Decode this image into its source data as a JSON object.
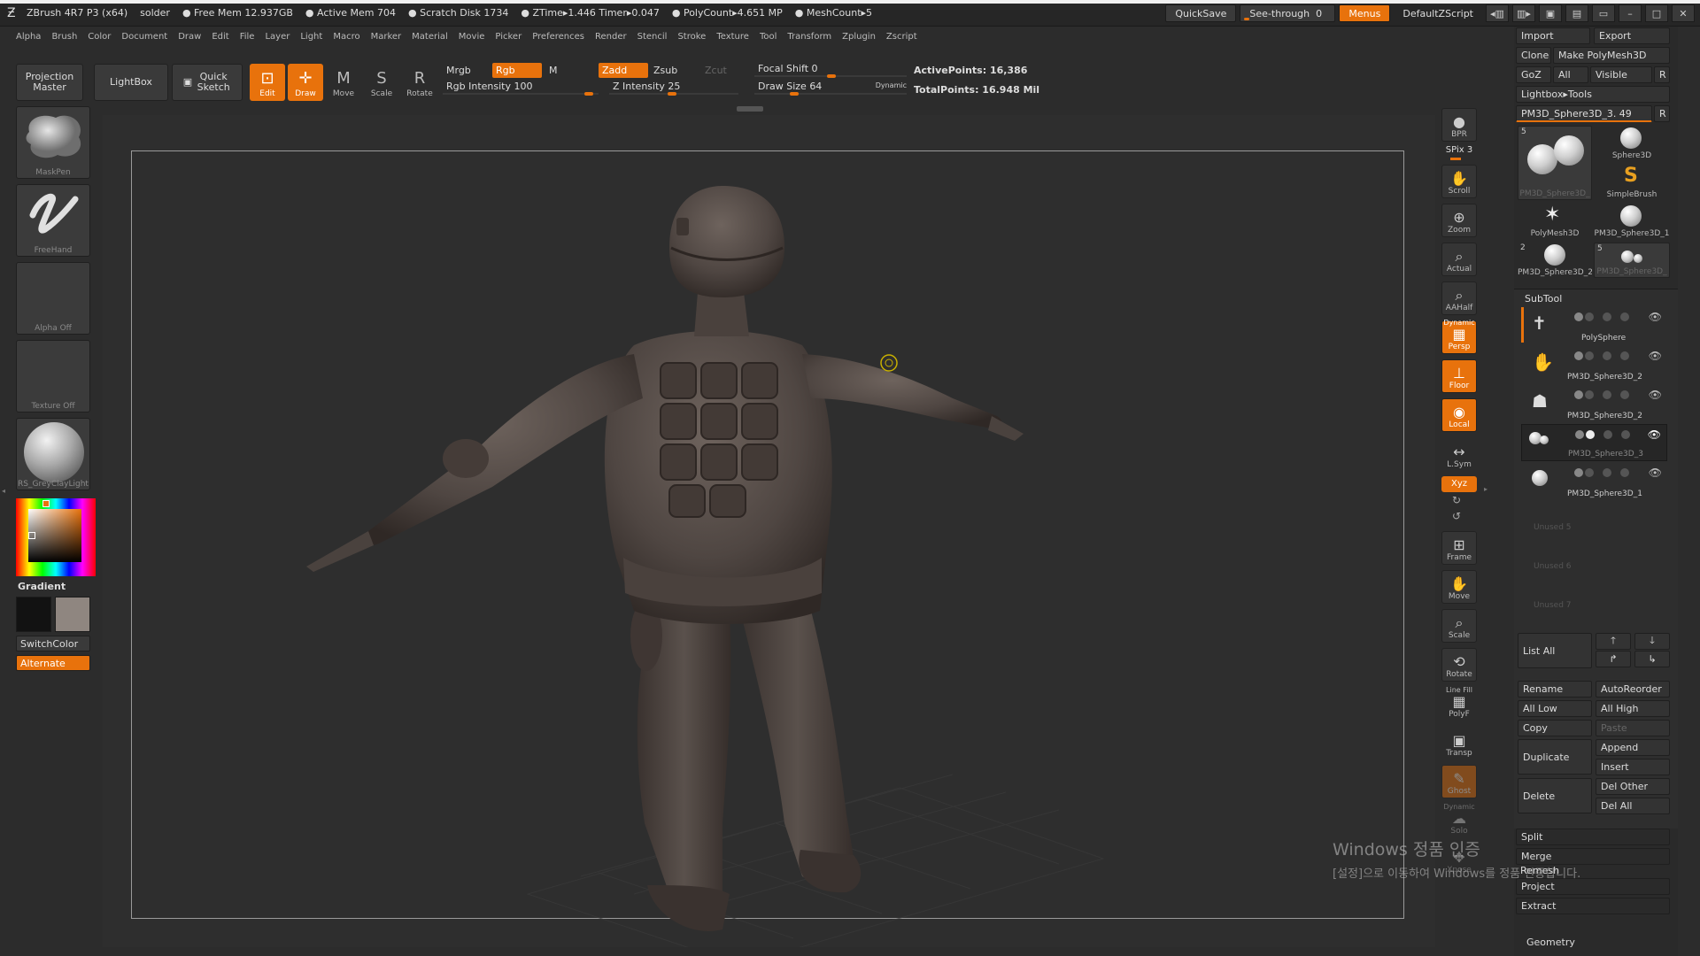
{
  "title_bar": {
    "app": "ZBrush 4R7 P3 (x64)",
    "file": "solder",
    "free_mem": "● Free Mem 12.937GB",
    "active_mem": "● Active Mem 704",
    "scratch": "● Scratch Disk 1734",
    "ztime": "● ZTime▸1.446  Timer▸0.047",
    "polycount": "● PolyCount▸4.651  MP",
    "meshcount": "● MeshCount▸5",
    "quicksave": "QuickSave",
    "see_through_label": "See-through",
    "see_through_value": "0",
    "see_through_level": 0,
    "menus": "Menus",
    "script": "DefaultZScript"
  },
  "menu_bar": [
    "Alpha",
    "Brush",
    "Color",
    "Document",
    "Draw",
    "Edit",
    "File",
    "Layer",
    "Light",
    "Macro",
    "Marker",
    "Material",
    "Movie",
    "Picker",
    "Preferences",
    "Render",
    "Stencil",
    "Stroke",
    "Texture",
    "Tool",
    "Transform",
    "Zplugin",
    "Zscript"
  ],
  "toolbar": {
    "projection_master": "Projection Master",
    "lightbox": "LightBox",
    "quick_sketch": "Quick Sketch",
    "edit": "Edit",
    "draw": "Draw",
    "move": "Move",
    "scale": "Scale",
    "rotate": "Rotate",
    "mrgb": "Mrgb",
    "rgb": "Rgb",
    "m": "M",
    "zadd": "Zadd",
    "zsub": "Zsub",
    "zcut": "Zcut",
    "rgb_intensity_label": "Rgb  Intensity",
    "rgb_intensity": "100",
    "z_intensity_label": "Z  Intensity",
    "z_intensity": "25",
    "focal_shift_label": "Focal  Shift",
    "focal_shift": "0",
    "draw_size_label": "Draw  Size",
    "draw_size": "64",
    "dynamic": "Dynamic",
    "active_points": "ActivePoints: 16,386",
    "total_points": "TotalPoints: 16.948  Mil"
  },
  "left_shelf": {
    "brush": "MaskPen",
    "stroke": "FreeHand",
    "alpha": "Alpha  Off",
    "texture": "Texture  Off",
    "material": "RS_GreyClayLight",
    "gradient": "Gradient",
    "switch_color": "SwitchColor",
    "alternate": "Alternate",
    "main_color": "#121212",
    "secondary_color": "#8f8680"
  },
  "right_shelf": [
    {
      "name": "BPR",
      "icon": "bpr-icon"
    },
    {
      "name": "SPix 3",
      "icon": "spix-slider"
    },
    {
      "name": "Scroll",
      "icon": "scroll-icon"
    },
    {
      "name": "Zoom",
      "icon": "zoom-icon"
    },
    {
      "name": "Actual",
      "icon": "actual-icon"
    },
    {
      "name": "AAHalf",
      "icon": "aahalf-icon"
    },
    {
      "name": "Persp",
      "icon": "persp-icon",
      "top": "Dynamic"
    },
    {
      "name": "Floor",
      "icon": "floor-icon"
    },
    {
      "name": "Local",
      "icon": "local-icon"
    },
    {
      "name": "L.Sym",
      "icon": "lsym-icon"
    },
    {
      "name": "Xyz",
      "icon": "xyz-icon"
    },
    {
      "name": "Frame",
      "icon": "frame-icon"
    },
    {
      "name": "Move",
      "icon": "move-icon"
    },
    {
      "name": "Scale",
      "icon": "scale-icon"
    },
    {
      "name": "Rotate",
      "icon": "rotate-icon"
    },
    {
      "name": "PolyF",
      "icon": "polyf-icon",
      "top": "Line Fill"
    },
    {
      "name": "Transp",
      "icon": "transp-icon"
    },
    {
      "name": "Ghost",
      "icon": "ghost-icon"
    },
    {
      "name": "Solo",
      "icon": "solo-icon",
      "top": "Dynamic"
    },
    {
      "name": "Xpose",
      "icon": "xpose-icon"
    }
  ],
  "tool_panel": {
    "import": "Import",
    "export": "Export",
    "clone": "Clone",
    "make_polymesh": "Make PolyMesh3D",
    "goz": "GoZ",
    "all": "All",
    "visible": "Visible",
    "r": "R",
    "lightbox_tools": "Lightbox▸Tools",
    "current_tool": "PM3D_Sphere3D_3. 49",
    "tools": [
      {
        "label": "PM3D_Sphere3D_",
        "num": "5"
      },
      {
        "label": "Sphere3D",
        "num": ""
      },
      {
        "label": "SimpleBrush",
        "num": ""
      },
      {
        "label": "PolyMesh3D",
        "num": ""
      },
      {
        "label": "PM3D_Sphere3D_1",
        "num": ""
      },
      {
        "label": "PM3D_Sphere3D_2",
        "num": "2"
      },
      {
        "label": "PM3D_Sphere3D_",
        "num": "5"
      }
    ]
  },
  "subtool": {
    "title": "SubTool",
    "items": [
      "PolySphere",
      "PM3D_Sphere3D_2",
      "PM3D_Sphere3D_2",
      "PM3D_Sphere3D_3",
      "PM3D_Sphere3D_1"
    ],
    "unused": [
      "Unused  5",
      "Unused  6",
      "Unused  7"
    ],
    "list_all": "List  All",
    "rename": "Rename",
    "autoreorder": "AutoReorder",
    "all_low": "All  Low",
    "all_high": "All  High",
    "copy": "Copy",
    "paste": "Paste",
    "duplicate": "Duplicate",
    "append": "Append",
    "insert": "Insert",
    "delete": "Delete",
    "del_other": "Del  Other",
    "del_all": "Del  All",
    "split": "Split",
    "merge": "Merge",
    "remesh": "Remesh",
    "project": "Project",
    "extract": "Extract",
    "geometry": "Geometry"
  },
  "watermark": {
    "line1": "Windows 정품 인증",
    "line2": "[설정]으로 이동하여 Windows를 정품 인증합니다."
  },
  "colors": {
    "accent": "#e8720c",
    "clay": "#514844",
    "clay_dark": "#2f2825",
    "clay_light": "#6b615b"
  }
}
